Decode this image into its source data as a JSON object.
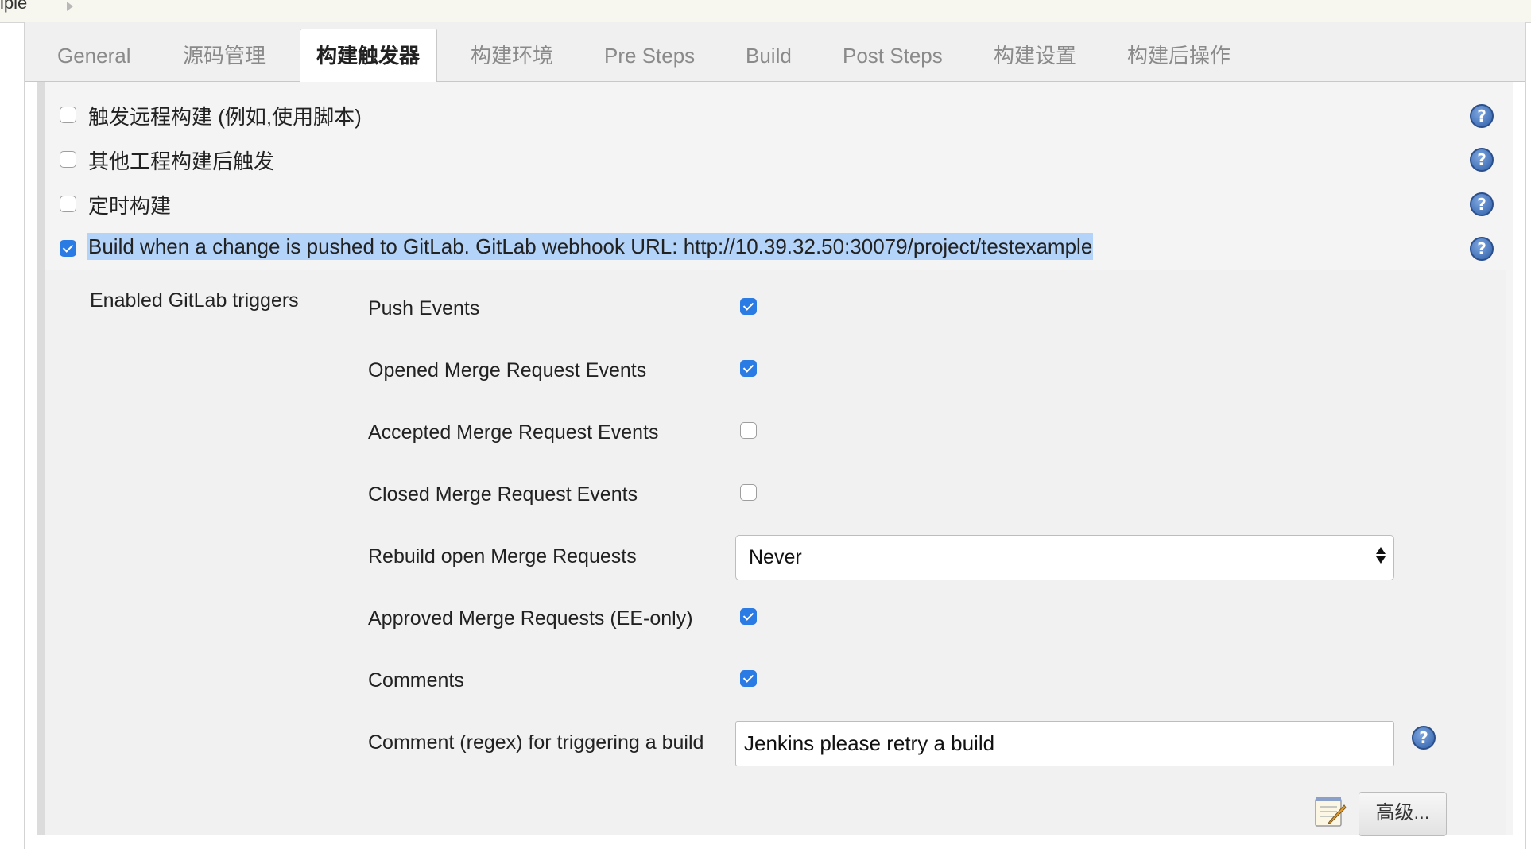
{
  "breadcrumb": {
    "project_fragment": "iple"
  },
  "tabs": [
    {
      "label": "General"
    },
    {
      "label": "源码管理"
    },
    {
      "label": "构建触发器"
    },
    {
      "label": "构建环境"
    },
    {
      "label": "Pre Steps"
    },
    {
      "label": "Build"
    },
    {
      "label": "Post Steps"
    },
    {
      "label": "构建设置"
    },
    {
      "label": "构建后操作"
    }
  ],
  "active_tab": "构建触发器",
  "triggers": [
    {
      "label": "触发远程构建 (例如,使用脚本)",
      "checked": false
    },
    {
      "label": "其他工程构建后触发",
      "checked": false
    },
    {
      "label": "定时构建",
      "checked": false
    },
    {
      "label": "Build when a change is pushed to GitLab. GitLab webhook URL: http://10.39.32.50:30079/project/testexample",
      "checked": true
    }
  ],
  "gitlab": {
    "section_label": "Enabled GitLab triggers",
    "options": [
      {
        "label": "Push Events",
        "checked": true
      },
      {
        "label": "Opened Merge Request Events",
        "checked": true
      },
      {
        "label": "Accepted Merge Request Events",
        "checked": false
      },
      {
        "label": "Closed Merge Request Events",
        "checked": false
      },
      {
        "label": "Rebuild open Merge Requests"
      },
      {
        "label": "Approved Merge Requests (EE-only)",
        "checked": true
      },
      {
        "label": "Comments",
        "checked": true
      },
      {
        "label": "Comment (regex) for triggering a build"
      }
    ],
    "rebuild_select_value": "Never",
    "comment_regex_value": "Jenkins please retry a build",
    "advanced_button": "高级..."
  },
  "help_glyph": "?",
  "colors": {
    "checkbox_checked": "#2b7be5",
    "selection_highlight": "#b3d3f9",
    "help_icon": "#2e5ea8"
  }
}
